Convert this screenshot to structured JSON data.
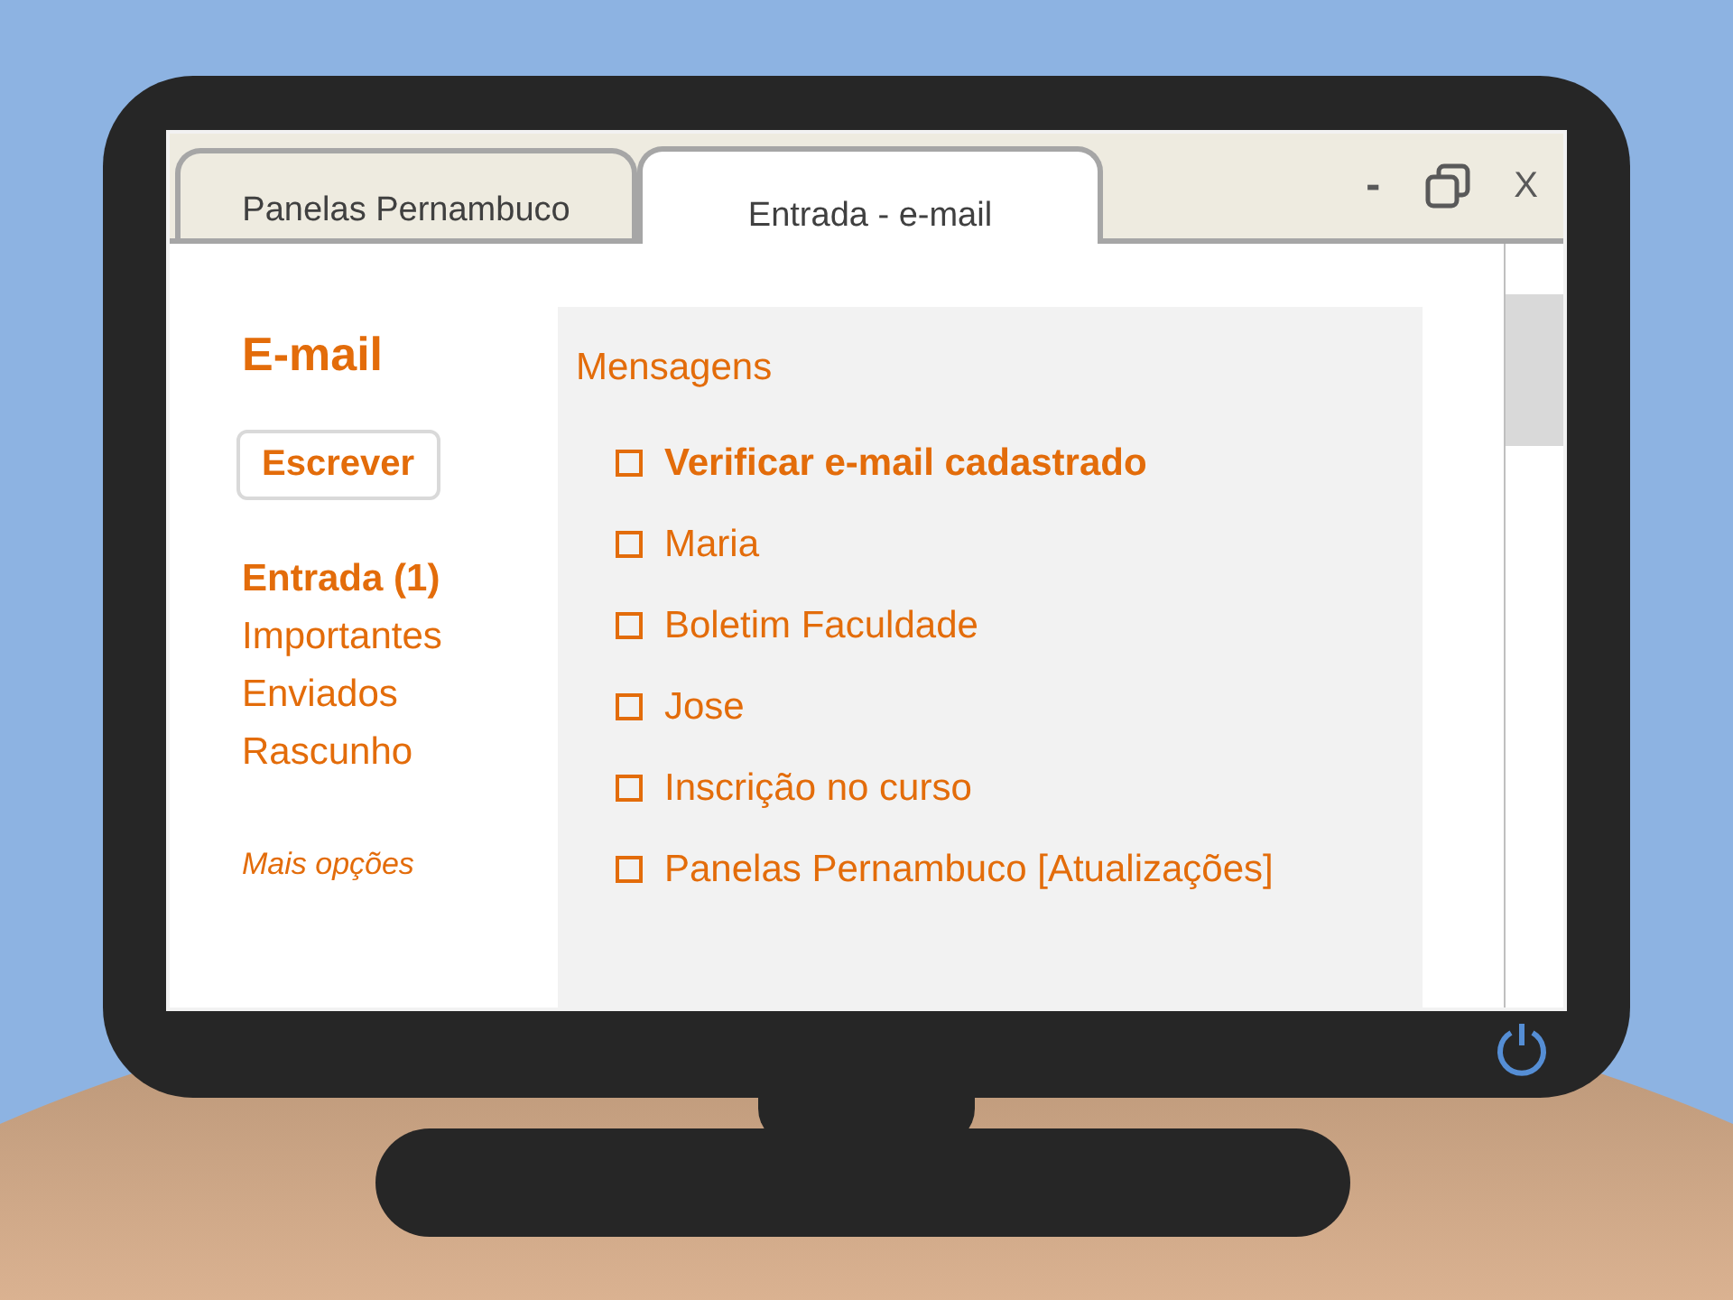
{
  "tabs": [
    {
      "label": "Panelas Pernambuco",
      "selected": false
    },
    {
      "label": "Entrada - e-mail",
      "selected": true
    }
  ],
  "window_controls": {
    "minimize": "-",
    "close": "X"
  },
  "sidebar": {
    "title": "E-mail",
    "compose_button": "Escrever",
    "folders": [
      {
        "label": "Entrada (1)",
        "selected": true
      },
      {
        "label": "Importantes",
        "selected": false
      },
      {
        "label": "Enviados",
        "selected": false
      },
      {
        "label": "Rascunho",
        "selected": false
      }
    ],
    "more_link": "Mais opções"
  },
  "messages": {
    "title": "Mensagens",
    "items": [
      {
        "subject": "Verificar e-mail cadastrado",
        "unread": true,
        "checked": false
      },
      {
        "subject": "Maria",
        "unread": false,
        "checked": false
      },
      {
        "subject": "Boletim Faculdade",
        "unread": false,
        "checked": false
      },
      {
        "subject": "Jose",
        "unread": false,
        "checked": false
      },
      {
        "subject": "Inscrição no curso",
        "unread": false,
        "checked": false
      },
      {
        "subject": "Panelas Pernambuco [Atualizações]",
        "unread": false,
        "checked": false
      }
    ]
  }
}
